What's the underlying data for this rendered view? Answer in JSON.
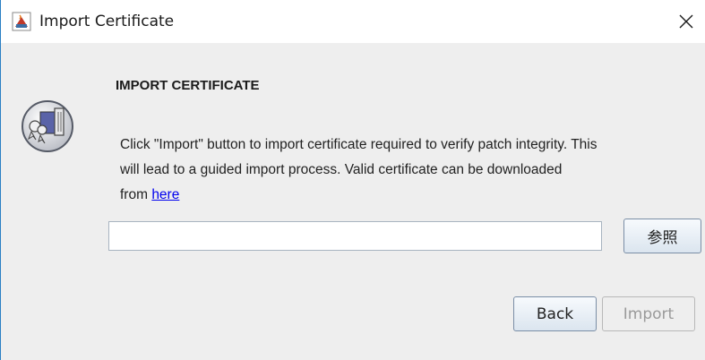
{
  "window": {
    "title": "Import Certificate",
    "app_icon": "java-cup-icon",
    "close_icon": "close-icon"
  },
  "dialog": {
    "heading": "IMPORT CERTIFICATE",
    "illustration": "certificate-import-icon",
    "description_line1": "Click \"Import\" button to import certificate required to verify patch integrity. This",
    "description_line2": "will lead to a guided import process. Valid certificate can be downloaded",
    "description_from": "from ",
    "link_text": "here"
  },
  "file_picker": {
    "value": "",
    "browse_label": "参照"
  },
  "buttons": {
    "back_label": "Back",
    "import_label": "Import"
  },
  "colors": {
    "link": "#0000ee",
    "window_border": "#2a7fc4",
    "disabled_text": "#9a9a9a"
  }
}
